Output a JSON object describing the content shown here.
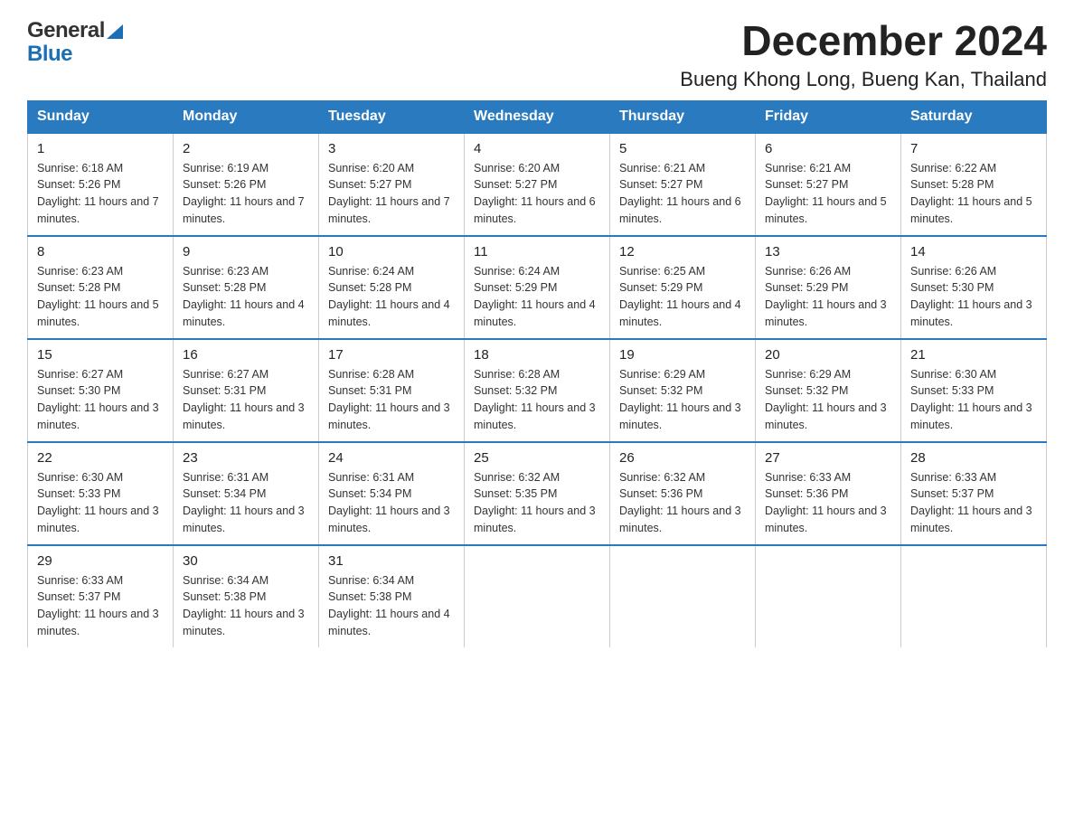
{
  "header": {
    "logo_general": "General",
    "logo_blue": "Blue",
    "title": "December 2024",
    "subtitle": "Bueng Khong Long, Bueng Kan, Thailand"
  },
  "days_of_week": [
    "Sunday",
    "Monday",
    "Tuesday",
    "Wednesday",
    "Thursday",
    "Friday",
    "Saturday"
  ],
  "weeks": [
    [
      {
        "day": "1",
        "sunrise": "6:18 AM",
        "sunset": "5:26 PM",
        "daylight": "11 hours and 7 minutes."
      },
      {
        "day": "2",
        "sunrise": "6:19 AM",
        "sunset": "5:26 PM",
        "daylight": "11 hours and 7 minutes."
      },
      {
        "day": "3",
        "sunrise": "6:20 AM",
        "sunset": "5:27 PM",
        "daylight": "11 hours and 7 minutes."
      },
      {
        "day": "4",
        "sunrise": "6:20 AM",
        "sunset": "5:27 PM",
        "daylight": "11 hours and 6 minutes."
      },
      {
        "day": "5",
        "sunrise": "6:21 AM",
        "sunset": "5:27 PM",
        "daylight": "11 hours and 6 minutes."
      },
      {
        "day": "6",
        "sunrise": "6:21 AM",
        "sunset": "5:27 PM",
        "daylight": "11 hours and 5 minutes."
      },
      {
        "day": "7",
        "sunrise": "6:22 AM",
        "sunset": "5:28 PM",
        "daylight": "11 hours and 5 minutes."
      }
    ],
    [
      {
        "day": "8",
        "sunrise": "6:23 AM",
        "sunset": "5:28 PM",
        "daylight": "11 hours and 5 minutes."
      },
      {
        "day": "9",
        "sunrise": "6:23 AM",
        "sunset": "5:28 PM",
        "daylight": "11 hours and 4 minutes."
      },
      {
        "day": "10",
        "sunrise": "6:24 AM",
        "sunset": "5:28 PM",
        "daylight": "11 hours and 4 minutes."
      },
      {
        "day": "11",
        "sunrise": "6:24 AM",
        "sunset": "5:29 PM",
        "daylight": "11 hours and 4 minutes."
      },
      {
        "day": "12",
        "sunrise": "6:25 AM",
        "sunset": "5:29 PM",
        "daylight": "11 hours and 4 minutes."
      },
      {
        "day": "13",
        "sunrise": "6:26 AM",
        "sunset": "5:29 PM",
        "daylight": "11 hours and 3 minutes."
      },
      {
        "day": "14",
        "sunrise": "6:26 AM",
        "sunset": "5:30 PM",
        "daylight": "11 hours and 3 minutes."
      }
    ],
    [
      {
        "day": "15",
        "sunrise": "6:27 AM",
        "sunset": "5:30 PM",
        "daylight": "11 hours and 3 minutes."
      },
      {
        "day": "16",
        "sunrise": "6:27 AM",
        "sunset": "5:31 PM",
        "daylight": "11 hours and 3 minutes."
      },
      {
        "day": "17",
        "sunrise": "6:28 AM",
        "sunset": "5:31 PM",
        "daylight": "11 hours and 3 minutes."
      },
      {
        "day": "18",
        "sunrise": "6:28 AM",
        "sunset": "5:32 PM",
        "daylight": "11 hours and 3 minutes."
      },
      {
        "day": "19",
        "sunrise": "6:29 AM",
        "sunset": "5:32 PM",
        "daylight": "11 hours and 3 minutes."
      },
      {
        "day": "20",
        "sunrise": "6:29 AM",
        "sunset": "5:32 PM",
        "daylight": "11 hours and 3 minutes."
      },
      {
        "day": "21",
        "sunrise": "6:30 AM",
        "sunset": "5:33 PM",
        "daylight": "11 hours and 3 minutes."
      }
    ],
    [
      {
        "day": "22",
        "sunrise": "6:30 AM",
        "sunset": "5:33 PM",
        "daylight": "11 hours and 3 minutes."
      },
      {
        "day": "23",
        "sunrise": "6:31 AM",
        "sunset": "5:34 PM",
        "daylight": "11 hours and 3 minutes."
      },
      {
        "day": "24",
        "sunrise": "6:31 AM",
        "sunset": "5:34 PM",
        "daylight": "11 hours and 3 minutes."
      },
      {
        "day": "25",
        "sunrise": "6:32 AM",
        "sunset": "5:35 PM",
        "daylight": "11 hours and 3 minutes."
      },
      {
        "day": "26",
        "sunrise": "6:32 AM",
        "sunset": "5:36 PM",
        "daylight": "11 hours and 3 minutes."
      },
      {
        "day": "27",
        "sunrise": "6:33 AM",
        "sunset": "5:36 PM",
        "daylight": "11 hours and 3 minutes."
      },
      {
        "day": "28",
        "sunrise": "6:33 AM",
        "sunset": "5:37 PM",
        "daylight": "11 hours and 3 minutes."
      }
    ],
    [
      {
        "day": "29",
        "sunrise": "6:33 AM",
        "sunset": "5:37 PM",
        "daylight": "11 hours and 3 minutes."
      },
      {
        "day": "30",
        "sunrise": "6:34 AM",
        "sunset": "5:38 PM",
        "daylight": "11 hours and 3 minutes."
      },
      {
        "day": "31",
        "sunrise": "6:34 AM",
        "sunset": "5:38 PM",
        "daylight": "11 hours and 4 minutes."
      },
      null,
      null,
      null,
      null
    ]
  ]
}
